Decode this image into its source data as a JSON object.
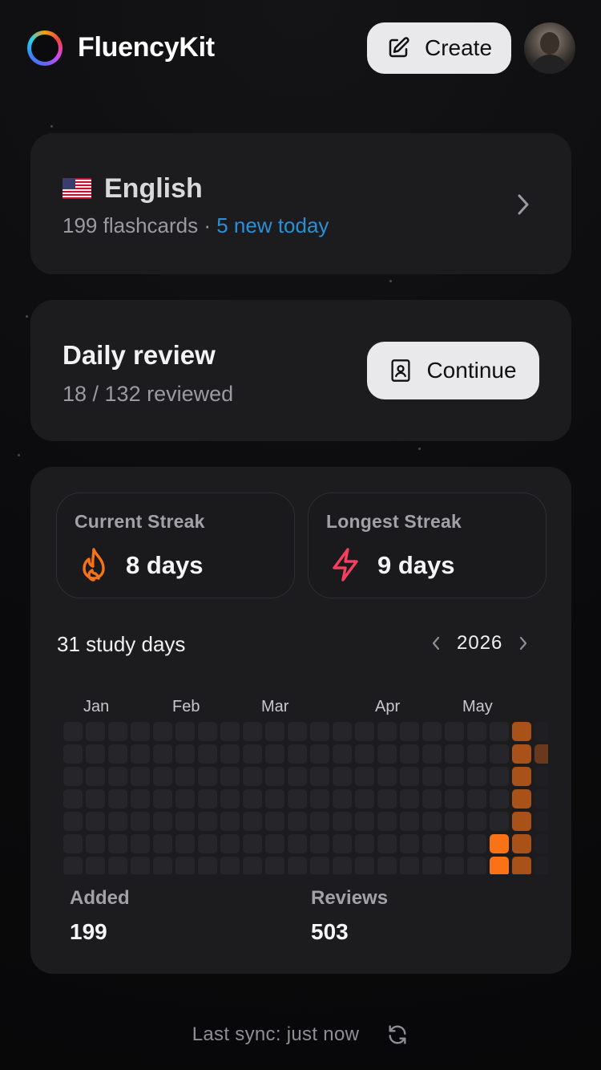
{
  "header": {
    "app_title": "FluencyKit",
    "create_label": "Create"
  },
  "language": {
    "name": "English",
    "flashcards": "199 flashcards",
    "separator": " · ",
    "new_today": "5 new today"
  },
  "review": {
    "title": "Daily review",
    "progress": "18 / 132 reviewed",
    "reviewed": 18,
    "total": 132,
    "continue_label": "Continue"
  },
  "streaks": {
    "current_label": "Current Streak",
    "current_value": "8 days",
    "longest_label": "Longest Streak",
    "longest_value": "9 days"
  },
  "calendar": {
    "study_days": "31 study days",
    "year": "2026",
    "months": [
      "Jan",
      "Feb",
      "Mar",
      "Apr",
      "May"
    ],
    "active_days_in_may": [
      "May 16",
      "May 17",
      "May 18",
      "May 19",
      "May 20",
      "May 21",
      "May 22",
      "May 23"
    ]
  },
  "metrics": {
    "added_label": "Added",
    "added_value": "199",
    "reviews_label": "Reviews",
    "reviews_value": "503"
  },
  "footer": {
    "sync_text": "Last sync: just now"
  },
  "colors": {
    "accent_blue": "#2b8fd6",
    "streak_orange": "#f97316",
    "longest_red": "#f43f5e",
    "heat_active": "#f97316",
    "heat_faded": "#a8521a",
    "heat_empty": "#26262a"
  },
  "icons": {
    "logo": "rainbow-ring-logo",
    "create": "edit-square-icon",
    "continue": "contact-book-icon",
    "current_streak": "flame-icon",
    "longest_streak": "lightning-icon",
    "sync": "refresh-icon"
  }
}
